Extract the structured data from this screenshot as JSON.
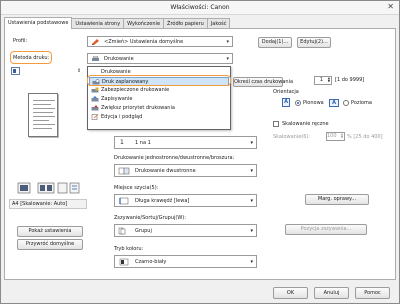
{
  "window": {
    "title": "Właściwości: Canon"
  },
  "tabs": [
    {
      "label": "Ustawienia podstawowe",
      "active": true
    },
    {
      "label": "Ustawienia strony"
    },
    {
      "label": "Wykończenie"
    },
    {
      "label": "Źródło papieru"
    },
    {
      "label": "Jakość"
    }
  ],
  "profile": {
    "label": "Profil:",
    "value": "<Zmień> Ustawienia domyślne",
    "add_button": "Dodaj(1)...",
    "edit_button": "Edytuj(2)..."
  },
  "output_method": {
    "label": "Metoda druku:",
    "value": "Drukowanie",
    "options": [
      "Drukowanie",
      "Druk zaplanowany",
      "Zabezpieczone drukowanie",
      "Zapisywanie",
      "Zwiększ priorytet drukowania",
      "Edycja i podgląd"
    ],
    "selected_index": 1
  },
  "schedule": {
    "label": "Określ czas drukowania"
  },
  "copies": {
    "value": "1",
    "range": "[1 do 9999]"
  },
  "orientation": {
    "label": "Orientacja",
    "portrait": "Pionowa",
    "landscape": "Pozioma"
  },
  "manual_scaling": {
    "label": "Skalowanie ręczne",
    "scaling_label": "Skalowanie(6):",
    "scaling_value": "100",
    "scaling_range": "% [25 do 400]"
  },
  "page_layout": {
    "value": "1 na 1",
    "num": "1"
  },
  "duplex": {
    "label": "Drukowanie jednostronne/dwustronne/broszura:",
    "value": "Drukowanie dwustronne"
  },
  "binding": {
    "label": "Miejsce szycia(5):",
    "value": "Długa krawędź [lewa]",
    "margin_button": "Marg. oprawy..."
  },
  "collate": {
    "label": "Zszywanie/Sortuj/Grupuj(W):",
    "value": "Grupuj",
    "staple_button": "Pozycja zszywania..."
  },
  "color_mode": {
    "label": "Tryb koloru:",
    "value": "Czarno-biały"
  },
  "preview": {
    "status": "A4 [Skalowanie: Auto]"
  },
  "left_buttons": {
    "show_settings": "Pokaż ustawienia",
    "restore_defaults": "Przywróć domyślne"
  },
  "bottom": {
    "ok": "OK",
    "cancel": "Anuluj",
    "help": "Pomoc"
  },
  "colors": {
    "highlight": "#f39c3e",
    "selected_item": "#cfe4f7"
  }
}
